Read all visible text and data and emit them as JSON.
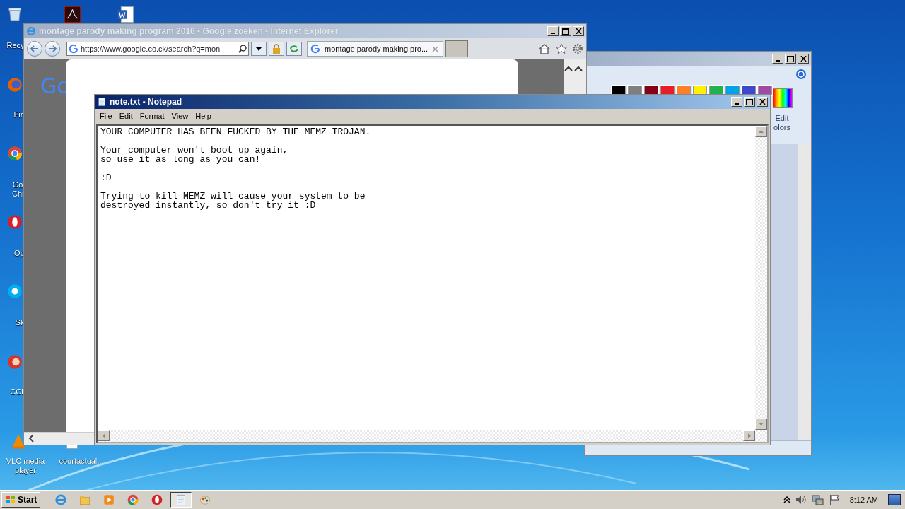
{
  "desktop": {
    "icons": [
      {
        "kind": "recycle",
        "label": "Recy"
      },
      {
        "kind": "acrobat"
      },
      {
        "kind": "word"
      },
      {
        "kind": "firefox",
        "label": "Fir"
      },
      {
        "kind": "chrome",
        "label": "Go Chr"
      },
      {
        "kind": "opera",
        "label": "Op"
      },
      {
        "kind": "skype",
        "label": "Sk"
      },
      {
        "kind": "ccleaner",
        "label": "CCl"
      },
      {
        "kind": "vlc",
        "label": "VLC media player"
      },
      {
        "kind": "file",
        "label": "courtactual..."
      }
    ]
  },
  "paint": {
    "active": false,
    "palette": [
      {
        "color": "#000000"
      },
      {
        "color": "#7f7f7f"
      },
      {
        "color": "#880015"
      },
      {
        "color": "#ed1c24"
      },
      {
        "color": "#ff7f27"
      },
      {
        "color": "#fff200"
      },
      {
        "color": "#22b14c"
      },
      {
        "color": "#00a2e8"
      },
      {
        "color": "#3f48cc"
      },
      {
        "color": "#a349a4"
      }
    ],
    "edit_colors": "Edit olors"
  },
  "ie": {
    "active": false,
    "title": "montage parody making program 2016 - Google zoeken - Internet Explorer",
    "address": "https://www.google.co.ck/search?q=mon",
    "tab": {
      "title": "montage parody making pro...",
      "selected": true
    },
    "page_logo": "Go"
  },
  "notepad": {
    "active": true,
    "title": "note.txt - Notepad",
    "menu": [
      "File",
      "Edit",
      "Format",
      "View",
      "Help"
    ],
    "text": "YOUR COMPUTER HAS BEEN FUCKED BY THE MEMZ TROJAN.\n\nYour computer won't boot up again,\nso use it as long as you can!\n\n:D\n\nTrying to kill MEMZ will cause your system to be\ndestroyed instantly, so don't try it :D"
  },
  "taskbar": {
    "start": "Start",
    "buttons": [
      {
        "kind": "ie",
        "selected": false
      },
      {
        "kind": "explorer",
        "selected": false
      },
      {
        "kind": "media",
        "selected": false
      },
      {
        "kind": "chrome",
        "selected": false
      },
      {
        "kind": "opera",
        "selected": false
      },
      {
        "kind": "notepad",
        "selected": true
      },
      {
        "kind": "paint",
        "selected": false
      }
    ],
    "clock": "8:12 AM"
  }
}
